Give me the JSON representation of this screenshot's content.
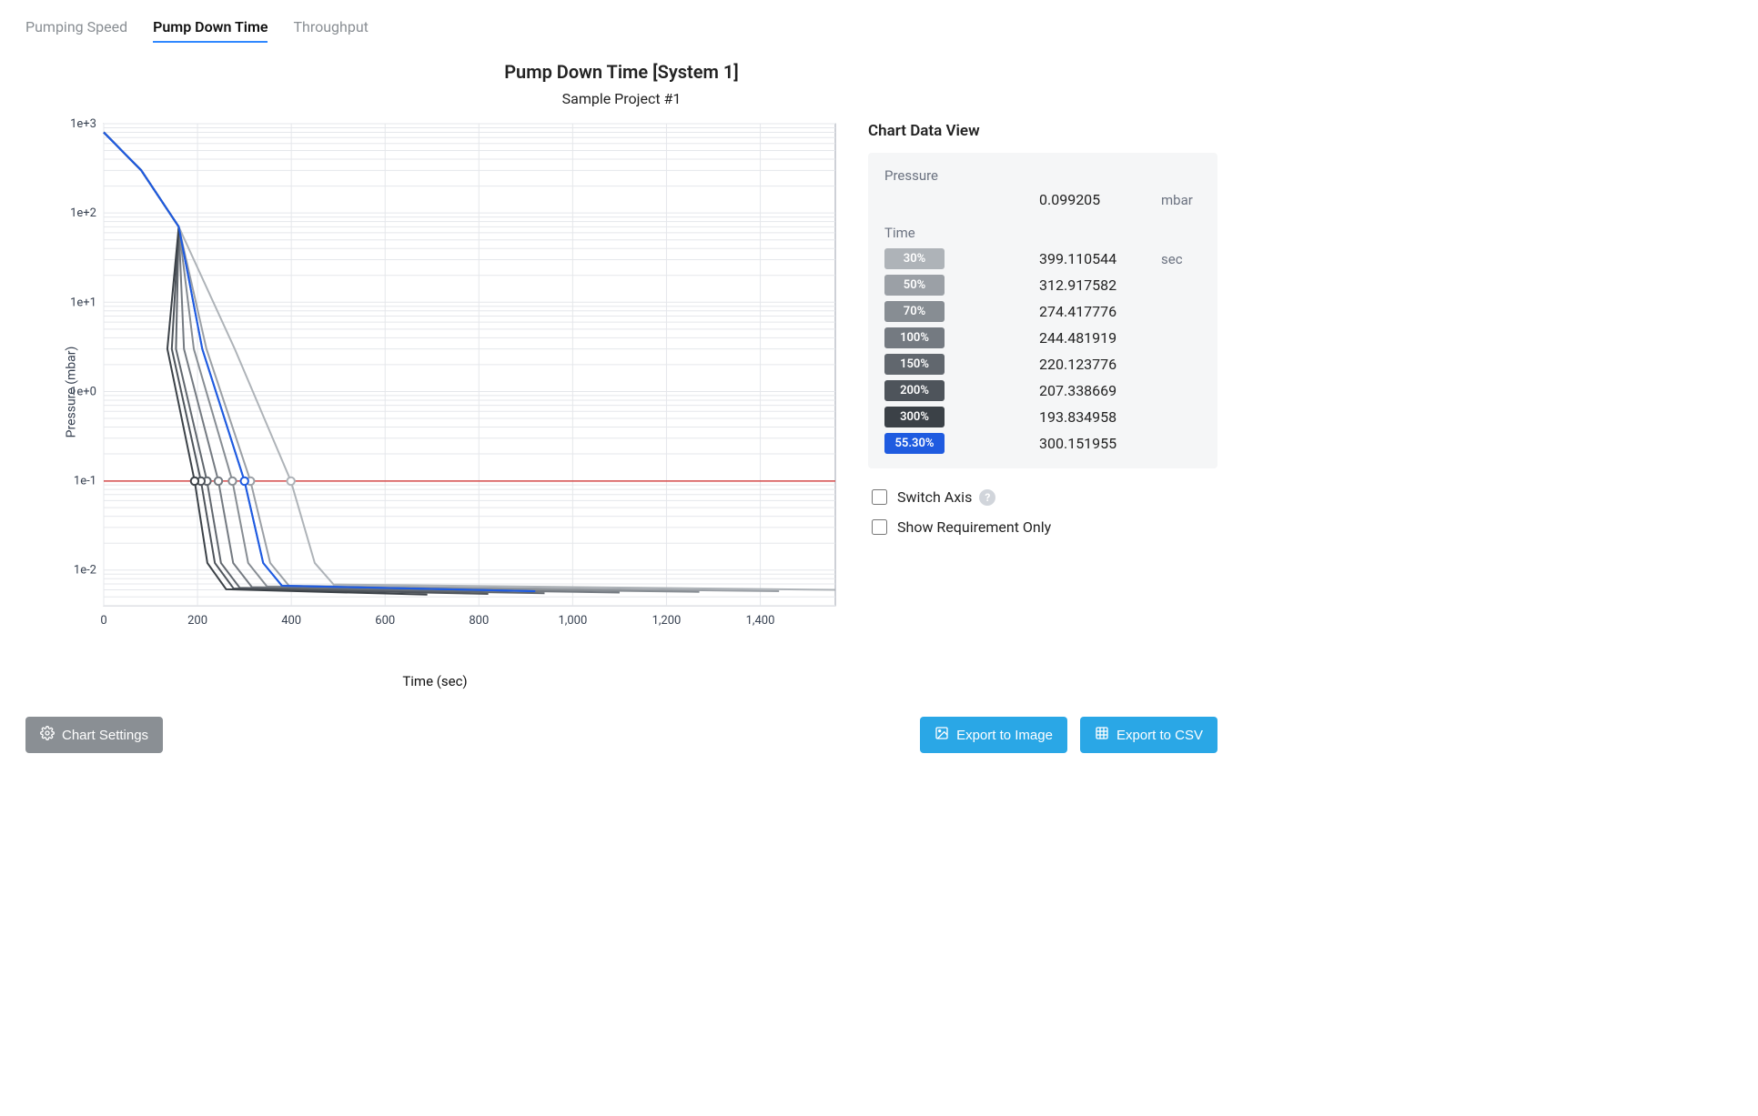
{
  "tabs": [
    {
      "label": "Pumping Speed",
      "active": false
    },
    {
      "label": "Pump Down Time",
      "active": true
    },
    {
      "label": "Throughput",
      "active": false
    }
  ],
  "chart": {
    "title": "Pump Down Time [System 1]",
    "subtitle": "Sample Project #1",
    "xlabel": "Time (sec)",
    "ylabel": "Pressure (mbar)"
  },
  "sidebar": {
    "title": "Chart Data View",
    "pressure_label": "Pressure",
    "pressure_value": "0.099205",
    "pressure_unit": "mbar",
    "time_label": "Time",
    "time_unit": "sec",
    "rows": [
      {
        "tag": "30%",
        "value": "399.110544"
      },
      {
        "tag": "50%",
        "value": "312.917582"
      },
      {
        "tag": "70%",
        "value": "274.417776"
      },
      {
        "tag": "100%",
        "value": "244.481919"
      },
      {
        "tag": "150%",
        "value": "220.123776"
      },
      {
        "tag": "200%",
        "value": "207.338669"
      },
      {
        "tag": "300%",
        "value": "193.834958"
      },
      {
        "tag": "55.30%",
        "value": "300.151955"
      }
    ],
    "checks": {
      "switch_axis": "Switch Axis",
      "show_req_only": "Show Requirement Only"
    }
  },
  "buttons": {
    "settings": "Chart Settings",
    "export_image": "Export to Image",
    "export_csv": "Export to CSV"
  },
  "chart_data": {
    "type": "line",
    "title": "Pump Down Time [System 1]",
    "subtitle": "Sample Project #1",
    "xlabel": "Time (sec)",
    "ylabel": "Pressure (mbar)",
    "xlim": [
      0,
      1560
    ],
    "ylim_log10": [
      -2.4,
      3.0
    ],
    "x_ticks": [
      0,
      200,
      400,
      600,
      800,
      1000,
      1200,
      1400
    ],
    "y_ticks": [
      0.01,
      0.1,
      1.0,
      10.0,
      100.0,
      1000.0
    ],
    "y_tick_labels": [
      "1e-2",
      "1e-1",
      "1e+0",
      "1e+1",
      "1e+2",
      "1e+3"
    ],
    "reference_pressure": 0.099205,
    "series_palette": {
      "30%": "#aeb3b8",
      "50%": "#9ba0a6",
      "70%": "#878d93",
      "100%": "#747a81",
      "150%": "#61676e",
      "200%": "#4e545b",
      "300%": "#3b4147",
      "55.30%": "#1f5be0"
    },
    "markers_at_ref": {
      "30%": 399.110544,
      "50%": 312.917582,
      "70%": 274.417776,
      "100%": 244.481919,
      "150%": 220.123776,
      "200%": 207.338669,
      "300%": 193.834958,
      "55.30%": 300.151955
    },
    "series": [
      {
        "name": "30%",
        "tref": 399.110544,
        "t2": 450,
        "plateau": 0.006,
        "end": 1560
      },
      {
        "name": "50%",
        "tref": 312.917582,
        "t2": 355,
        "plateau": 0.0058,
        "end": 1440
      },
      {
        "name": "70%",
        "tref": 274.417776,
        "t2": 308,
        "plateau": 0.0057,
        "end": 1270
      },
      {
        "name": "100%",
        "tref": 244.481919,
        "t2": 276,
        "plateau": 0.0056,
        "end": 1100
      },
      {
        "name": "150%",
        "tref": 220.123776,
        "t2": 250,
        "plateau": 0.0055,
        "end": 940
      },
      {
        "name": "200%",
        "tref": 207.338669,
        "t2": 237,
        "plateau": 0.0054,
        "end": 820
      },
      {
        "name": "300%",
        "tref": 193.834958,
        "t2": 221,
        "plateau": 0.0053,
        "end": 690
      },
      {
        "name": "55.30%",
        "tref": 300.151955,
        "t2": 340,
        "plateau": 0.0058,
        "end": 920
      }
    ]
  }
}
